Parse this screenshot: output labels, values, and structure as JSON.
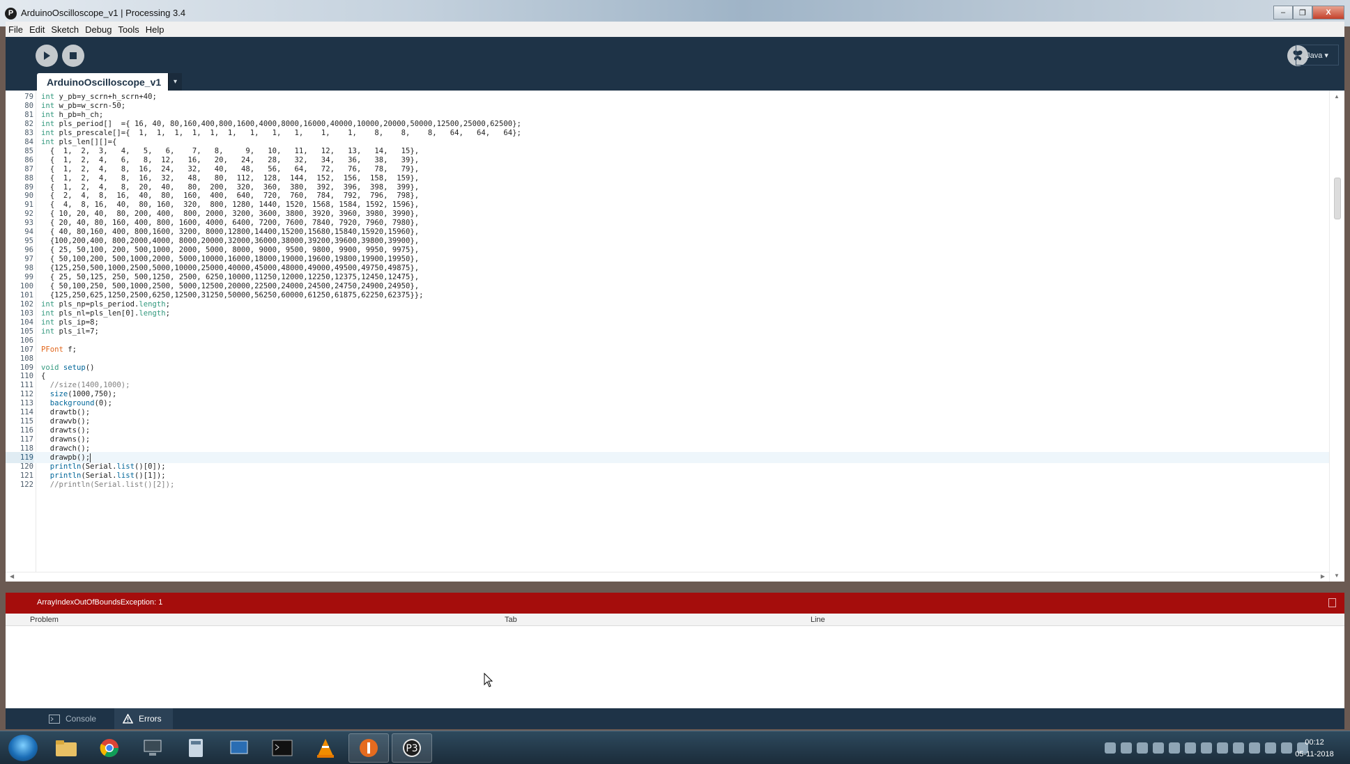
{
  "window": {
    "title": "ArduinoOscilloscope_v1 | Processing 3.4",
    "minimize_label": "–",
    "restore_label": "❐",
    "close_label": "X"
  },
  "menu": [
    "File",
    "Edit",
    "Sketch",
    "Debug",
    "Tools",
    "Help"
  ],
  "toolbar": {
    "run_icon": "play-icon",
    "stop_icon": "stop-icon",
    "mode_label": "Java ▾"
  },
  "tab": {
    "name": "ArduinoOscilloscope_v1",
    "menu_arrow": "▾"
  },
  "editor": {
    "current_line": 119,
    "lines": [
      {
        "n": "79",
        "t": "int y_pb=y_scrn+h_scrn+40;"
      },
      {
        "n": "80",
        "t": "int w_pb=w_scrn-50;"
      },
      {
        "n": "81",
        "t": "int h_pb=h_ch;"
      },
      {
        "n": "82",
        "t": "int pls_period[]  ={ 16, 40, 80,160,400,800,1600,4000,8000,16000,40000,10000,20000,50000,12500,25000,62500};"
      },
      {
        "n": "83",
        "t": "int pls_prescale[]={  1,  1,  1,  1,  1,  1,   1,   1,   1,    1,    1,    8,    8,    8,   64,   64,   64};"
      },
      {
        "n": "84",
        "t": "int pls_len[][]={"
      },
      {
        "n": "85",
        "t": "  {  1,  2,  3,   4,   5,   6,    7,   8,     9,   10,   11,   12,   13,   14,   15},"
      },
      {
        "n": "86",
        "t": "  {  1,  2,  4,   6,   8,  12,   16,   20,   24,   28,   32,   34,   36,   38,   39},"
      },
      {
        "n": "87",
        "t": "  {  1,  2,  4,   8,  16,  24,   32,   40,   48,   56,   64,   72,   76,   78,   79},"
      },
      {
        "n": "88",
        "t": "  {  1,  2,  4,   8,  16,  32,   48,   80,  112,  128,  144,  152,  156,  158,  159},"
      },
      {
        "n": "89",
        "t": "  {  1,  2,  4,   8,  20,  40,   80,  200,  320,  360,  380,  392,  396,  398,  399},"
      },
      {
        "n": "90",
        "t": "  {  2,  4,  8,  16,  40,  80,  160,  400,  640,  720,  760,  784,  792,  796,  798},"
      },
      {
        "n": "91",
        "t": "  {  4,  8, 16,  40,  80, 160,  320,  800, 1280, 1440, 1520, 1568, 1584, 1592, 1596},"
      },
      {
        "n": "92",
        "t": "  { 10, 20, 40,  80, 200, 400,  800, 2000, 3200, 3600, 3800, 3920, 3960, 3980, 3990},"
      },
      {
        "n": "93",
        "t": "  { 20, 40, 80, 160, 400, 800, 1600, 4000, 6400, 7200, 7600, 7840, 7920, 7960, 7980},"
      },
      {
        "n": "94",
        "t": "  { 40, 80,160, 400, 800,1600, 3200, 8000,12800,14400,15200,15680,15840,15920,15960},"
      },
      {
        "n": "95",
        "t": "  {100,200,400, 800,2000,4000, 8000,20000,32000,36000,38000,39200,39600,39800,39900},"
      },
      {
        "n": "96",
        "t": "  { 25, 50,100, 200, 500,1000, 2000, 5000, 8000, 9000, 9500, 9800, 9900, 9950, 9975},"
      },
      {
        "n": "97",
        "t": "  { 50,100,200, 500,1000,2000, 5000,10000,16000,18000,19000,19600,19800,19900,19950},"
      },
      {
        "n": "98",
        "t": "  {125,250,500,1000,2500,5000,10000,25000,40000,45000,48000,49000,49500,49750,49875},"
      },
      {
        "n": "99",
        "t": "  { 25, 50,125, 250, 500,1250, 2500, 6250,10000,11250,12000,12250,12375,12450,12475},"
      },
      {
        "n": "100",
        "t": "  { 50,100,250, 500,1000,2500, 5000,12500,20000,22500,24000,24500,24750,24900,24950},"
      },
      {
        "n": "101",
        "t": "  {125,250,625,1250,2500,6250,12500,31250,50000,56250,60000,61250,61875,62250,62375}};"
      },
      {
        "n": "102",
        "t": "int pls_np=pls_period.length;"
      },
      {
        "n": "103",
        "t": "int pls_nl=pls_len[0].length;"
      },
      {
        "n": "104",
        "t": "int pls_ip=8;"
      },
      {
        "n": "105",
        "t": "int pls_il=7;"
      },
      {
        "n": "106",
        "t": ""
      },
      {
        "n": "107",
        "t": "PFont f;"
      },
      {
        "n": "108",
        "t": ""
      },
      {
        "n": "109",
        "t": "void setup()"
      },
      {
        "n": "110",
        "t": "{"
      },
      {
        "n": "111",
        "t": "  //size(1400,1000);"
      },
      {
        "n": "112",
        "t": "  size(1000,750);"
      },
      {
        "n": "113",
        "t": "  background(0);"
      },
      {
        "n": "114",
        "t": "  drawtb();"
      },
      {
        "n": "115",
        "t": "  drawvb();"
      },
      {
        "n": "116",
        "t": "  drawts();"
      },
      {
        "n": "117",
        "t": "  drawns();"
      },
      {
        "n": "118",
        "t": "  drawch();"
      },
      {
        "n": "119",
        "t": "  drawpb();"
      },
      {
        "n": "120",
        "t": "  println(Serial.list()[0]);"
      },
      {
        "n": "121",
        "t": "  println(Serial.list()[1]);"
      },
      {
        "n": "122",
        "t": "  //println(Serial.list()[2]);"
      }
    ]
  },
  "error": {
    "message": "ArrayIndexOutOfBoundsException: 1"
  },
  "problems": {
    "columns": [
      "Problem",
      "Tab",
      "Line"
    ]
  },
  "footer": {
    "console_label": "Console",
    "errors_label": "Errors"
  },
  "taskbar": {
    "time": "00:12",
    "date": "05-11-2018"
  }
}
